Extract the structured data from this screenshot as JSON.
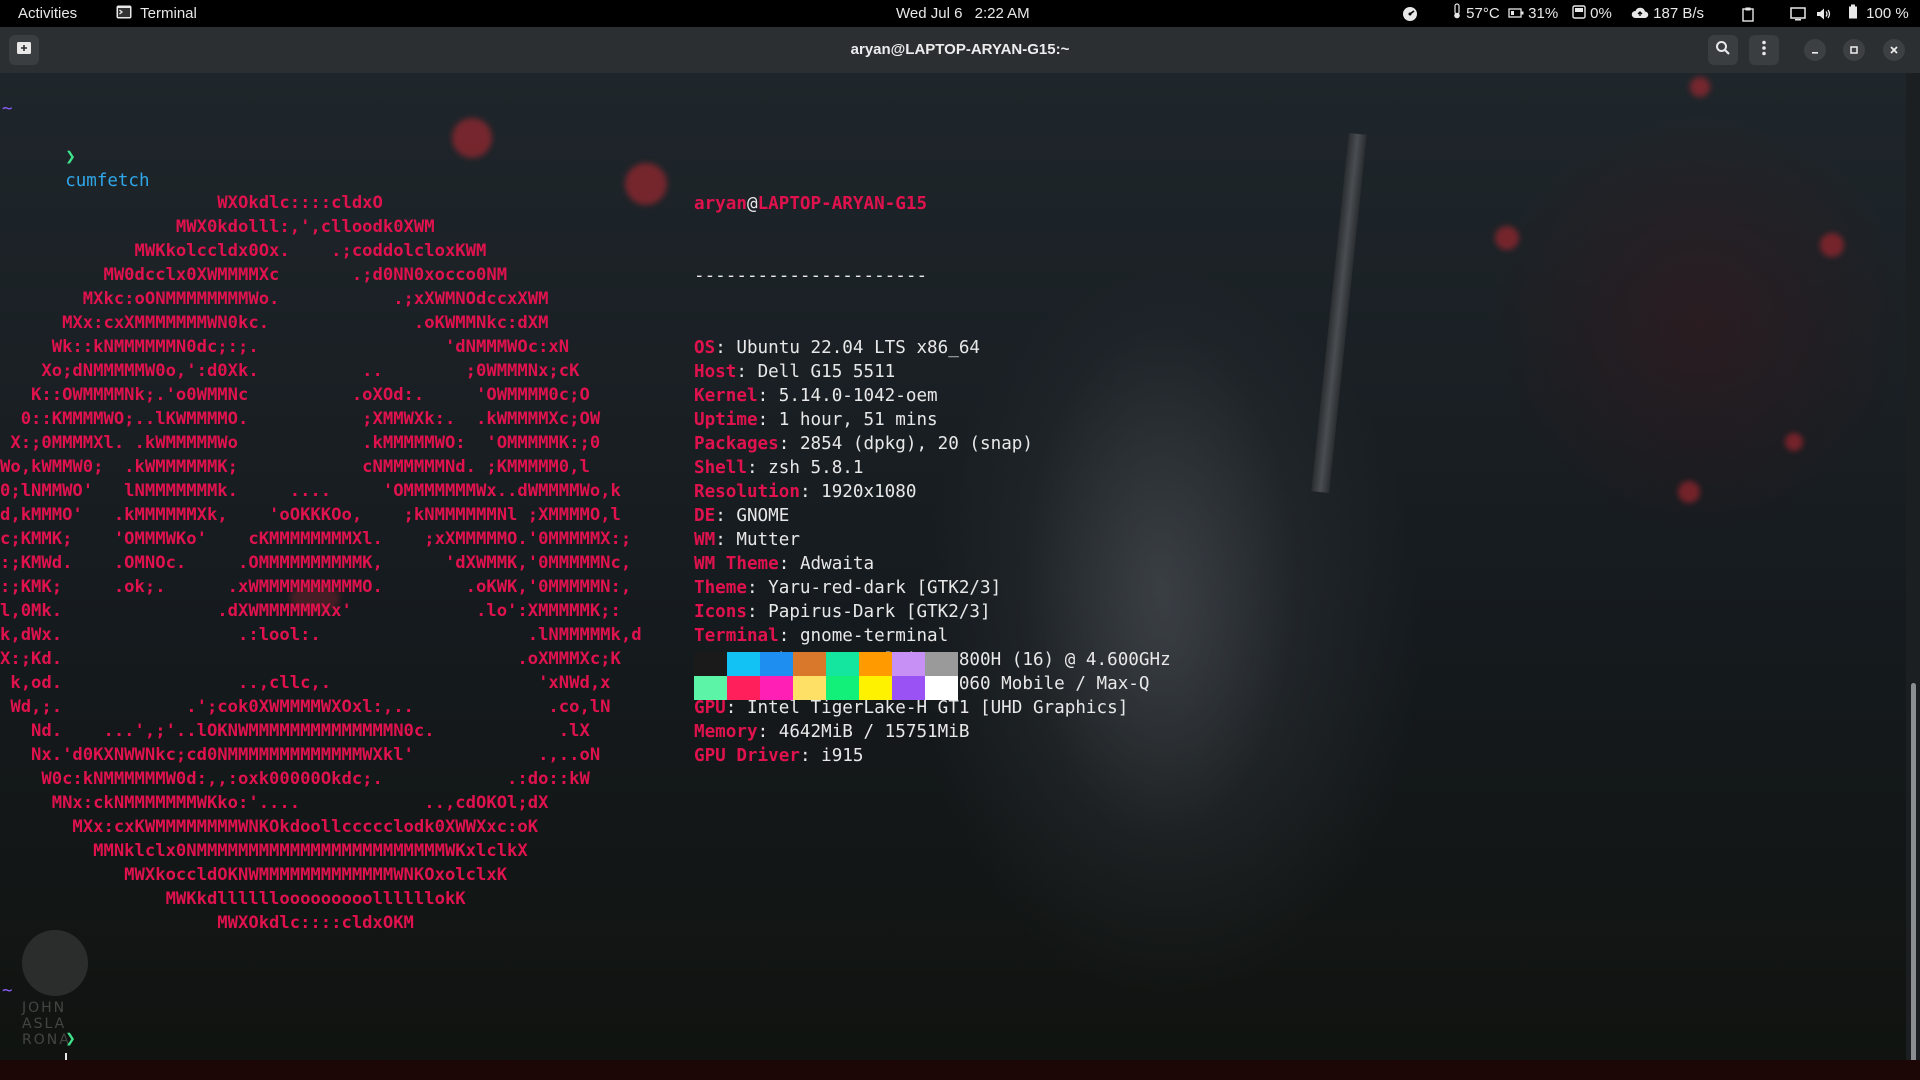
{
  "topbar": {
    "activities": "Activities",
    "app_name": "Terminal",
    "date": "Wed Jul 6",
    "time": "2:22 AM",
    "temperature": "57°C",
    "battery_health": "31%",
    "disk": "0%",
    "network": "187 B/s",
    "battery": "100 %"
  },
  "window": {
    "title": "aryan@LAPTOP-ARYAN-G15:~"
  },
  "terminal": {
    "prompt_dir": "~",
    "prompt_symbol": "❯",
    "command": "cumfetch",
    "ascii_art": "                     WXOkdlc::::cldxO\n                 MWX0kdolll:,',clloodk0XWM\n             MWKkolccldx0Ox.    .;coddolcloxKWM\n          MW0dcclx0XWMMMMXc       .;d0NN0xocco0NM\n        MXkc:oONMMMMMMMMWo.           .;xXWMNOdccxXWM\n      MXx:cxXMMMMMMMWN0kc.              .oKWMMNkc:dXM\n     Wk::kNMMMMMMN0dc;:;.                  'dNMMMWOc:xN\n    Xo;dNMMMMMW0o,':d0Xk.          ..        ;0WMMMNx;cK\n   K::OWMMMMNk;.'o0WMMNc          .oXOd:.     'OWMMMM0c;O\n  0::KMMMMWO;..lKWMMMMO.           ;XMMWXk:.  .kWMMMMXc;OW\n X:;0MMMMXl. .kWMMMMMWo            .kMMMMMWO:  'OMMMMMK:;0\nWo,kWMMW0;  .kWMMMMMMK;            cNMMMMMMNd. ;KMMMMM0,l\n0;lNMMWO'   lNMMMMMMMk.     ....     'OMMMMMMMWx..dWMMMMWo,k\nd,kMMMO'   .kMMMMMMXk,    'oOKKKOo,    ;kNMMMMMMNl ;XMMMMO,l\nc;KMMK;    'OMMMWKo'    cKMMMMMMMMXl.    ;xXMMMMMO.'0MMMMMX:;\n:;KMWd.    .OMNOc.     .OMMMMMMMMMMK,      'dXWMMK,'0MMMMMNc,\n:;KMK;     .ok;.      .xWMMMMMMMMMMO.        .oKWK,'0MMMMMN:,\nl,0Mk.               .dXWMMMMMMXx'            .lo':XMMMMMK;:\nk,dWx.                 .:lool:.                    .lNMMMMMk,d\nX:;Kd.                                            .oXMMMXc;K\n k,od.                 ..,cllc,.                    'xNWd,x\n Wd,;.            .';cok0XWMMMMWXOxl:,..             .co,lN\n   Nd.    ...',;'..lOKNWMMMMMMMMMMMMMMN0c.            .lX\n   Nx.'d0KXNWWNkc;cd0NMMMMMMMMMMMMMWXkl'            .,..oN\n    W0c:kNMMMMMMW0d:,,:oxk00000Okdc;.            .:do::kW\n     MNx:ckNMMMMMMMWKko:'....            ..,cdOKOl;dX\n       MXx:cxKWMMMMMMMMWNKOkdoollccccclodk0XWWXxc:oK\n         MMNklclx0NMMMMMMMMMMMMMMMMMMMMMMMMWKxlclkX\n            MWXkoccldOKNWMMMMMMMMMMMMMWNKOxolclxK\n                MWKkdllllllooooooooollllllokK\n                     MWXOkdlc::::cldxOKM",
    "user": "aryan",
    "at": "@",
    "host": "LAPTOP-ARYAN-G15",
    "separator": "----------------------",
    "info": [
      {
        "key": "OS",
        "value": "Ubuntu 22.04 LTS x86_64"
      },
      {
        "key": "Host",
        "value": "Dell G15 5511"
      },
      {
        "key": "Kernel",
        "value": "5.14.0-1042-oem"
      },
      {
        "key": "Uptime",
        "value": "1 hour, 51 mins"
      },
      {
        "key": "Packages",
        "value": "2854 (dpkg), 20 (snap)"
      },
      {
        "key": "Shell",
        "value": "zsh 5.8.1"
      },
      {
        "key": "Resolution",
        "value": "1920x1080"
      },
      {
        "key": "DE",
        "value": "GNOME"
      },
      {
        "key": "WM",
        "value": "Mutter"
      },
      {
        "key": "WM Theme",
        "value": "Adwaita"
      },
      {
        "key": "Theme",
        "value": "Yaru-red-dark [GTK2/3]"
      },
      {
        "key": "Icons",
        "value": "Papirus-Dark [GTK2/3]"
      },
      {
        "key": "Terminal",
        "value": "gnome-terminal"
      },
      {
        "key": "CPU",
        "value": "11th Gen Intel i7-11800H (16) @ 4.600GHz"
      },
      {
        "key": "GPU",
        "value": "NVIDIA GeForce RTX 3060 Mobile / Max-Q"
      },
      {
        "key": "GPU",
        "value": "Intel TigerLake-H GT1 [UHD Graphics]"
      },
      {
        "key": "Memory",
        "value": "4642MiB / 15751MiB"
      },
      {
        "key": "GPU Driver",
        "value": "i915"
      }
    ],
    "palette_top": [
      "#1a1a1a",
      "#12c2f5",
      "#1e8ff0",
      "#d9772b",
      "#14e6a0",
      "#ff9a00",
      "#c790f5",
      "#9a9a9a"
    ],
    "palette_bottom": [
      "#5cf5a8",
      "#ff1f5a",
      "#ff1fb4",
      "#ffe066",
      "#12f07a",
      "#fff200",
      "#9a52f5",
      "#ffffff"
    ]
  },
  "watermark": [
    "JOHN",
    "ASLA",
    "RONA"
  ],
  "colors": {
    "accent": "#e0124e",
    "prompt_arrow": "#3ee38b",
    "command": "#2fa6e8",
    "prompt_tilde": "#8a5cf6"
  },
  "icons": {
    "app": "terminal-icon",
    "new_tab": "new-tab-icon",
    "search": "search-icon",
    "menu": "hamburger-menu-icon"
  }
}
